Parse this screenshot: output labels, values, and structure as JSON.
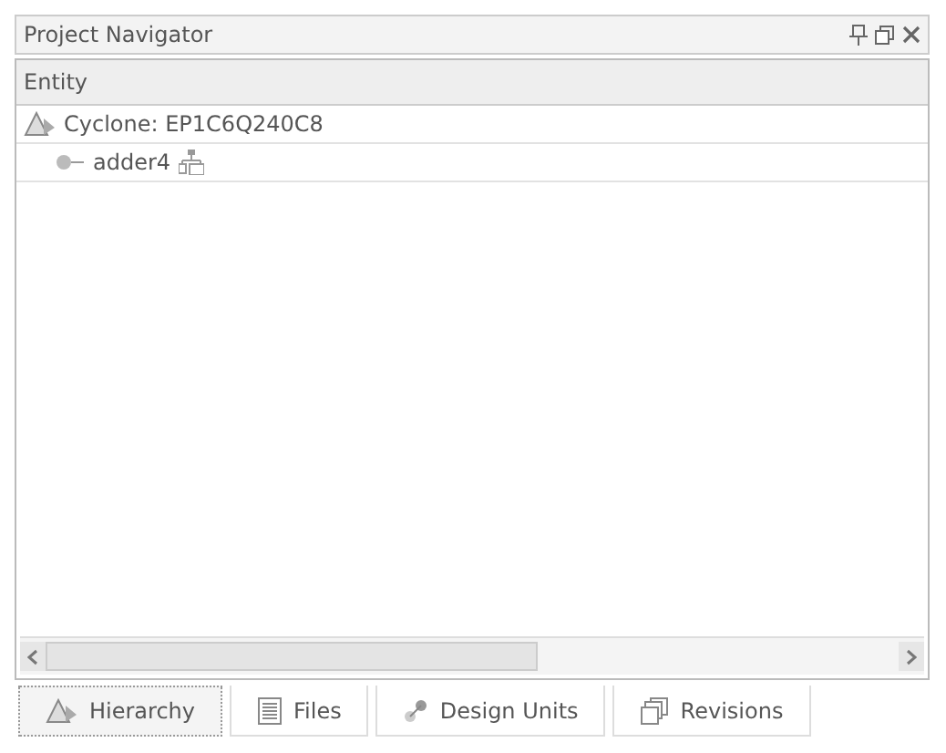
{
  "window": {
    "title": "Project Navigator"
  },
  "table": {
    "columns": [
      "Entity"
    ],
    "tree": [
      {
        "label": "Cyclone: EP1C6Q240C8",
        "kind": "device",
        "children": [
          {
            "label": "adder4",
            "kind": "entity"
          }
        ]
      }
    ]
  },
  "tabs": [
    {
      "label": "Hierarchy",
      "kind": "hierarchy",
      "selected": true
    },
    {
      "label": "Files",
      "kind": "files",
      "selected": false
    },
    {
      "label": "Design Units",
      "kind": "units",
      "selected": false
    },
    {
      "label": "Revisions",
      "kind": "revisions",
      "selected": false
    }
  ]
}
